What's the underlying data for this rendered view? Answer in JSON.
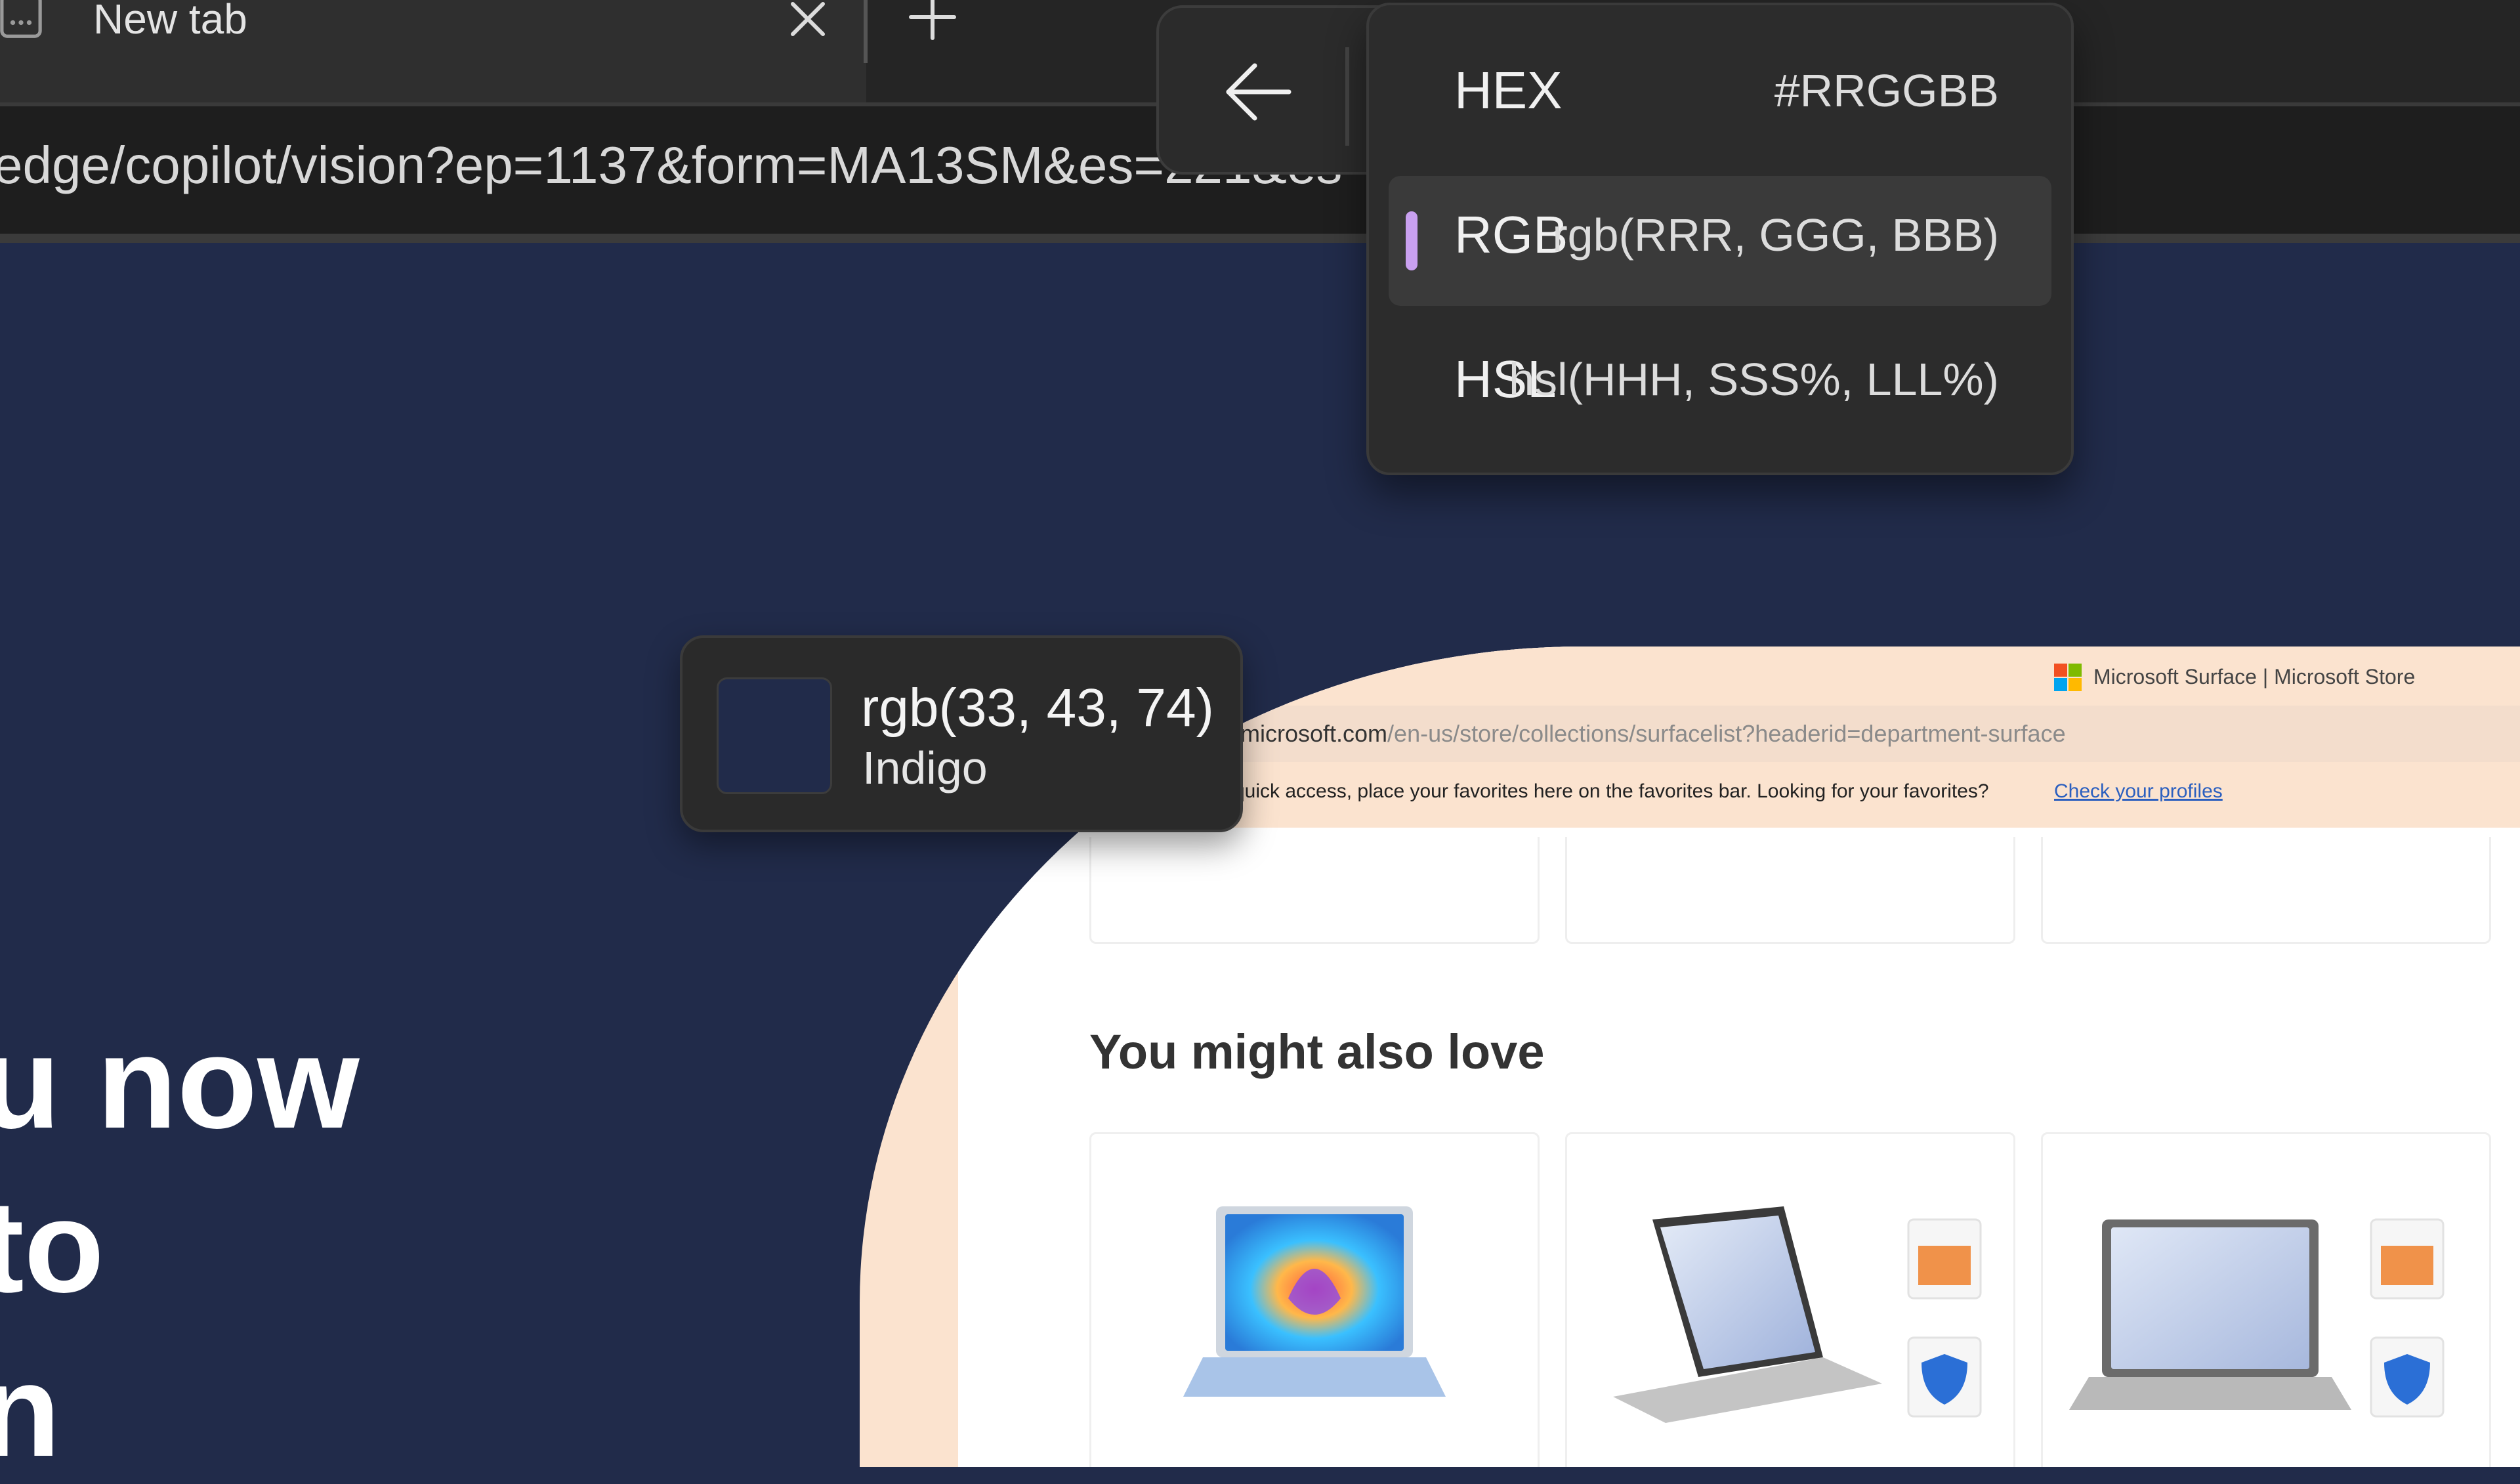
{
  "browser": {
    "tab_title": "New tab",
    "url": "edge/copilot/vision?ep=1137&form=MA13SM&es=221&es"
  },
  "format_menu": {
    "items": [
      {
        "label": "HEX",
        "value": "#RRGGBB",
        "selected": false
      },
      {
        "label": "RGB",
        "value": "rgb(RRR, GGG, BBB)",
        "selected": true
      },
      {
        "label": "HSL",
        "value": "hsl(HHH, SSS%, LLL%)",
        "selected": false
      }
    ],
    "accent_color": "#c9a0f0"
  },
  "color_picker": {
    "value": "rgb(33, 43, 74)",
    "name": "Indigo",
    "swatch_color": "#212b4a"
  },
  "hero": {
    "lines": [
      "u now",
      "to",
      "n"
    ]
  },
  "store_page": {
    "tab_title": "Microsoft Surface | Microsoft Store",
    "url_host": ".microsoft.com",
    "url_path": "/en-us/store/collections/surfacelist?headerid=department-surface",
    "favorites_text": "quick access, place your favorites here on the favorites bar. Looking for your favorites?",
    "favorites_link": "Check your profiles",
    "section_title": "You might also love"
  },
  "icons": {
    "tab": "tab-page-icon",
    "close": "close-icon",
    "new_tab": "plus-icon",
    "back": "arrow-left-icon",
    "ms_logo": "microsoft-logo-icon"
  }
}
